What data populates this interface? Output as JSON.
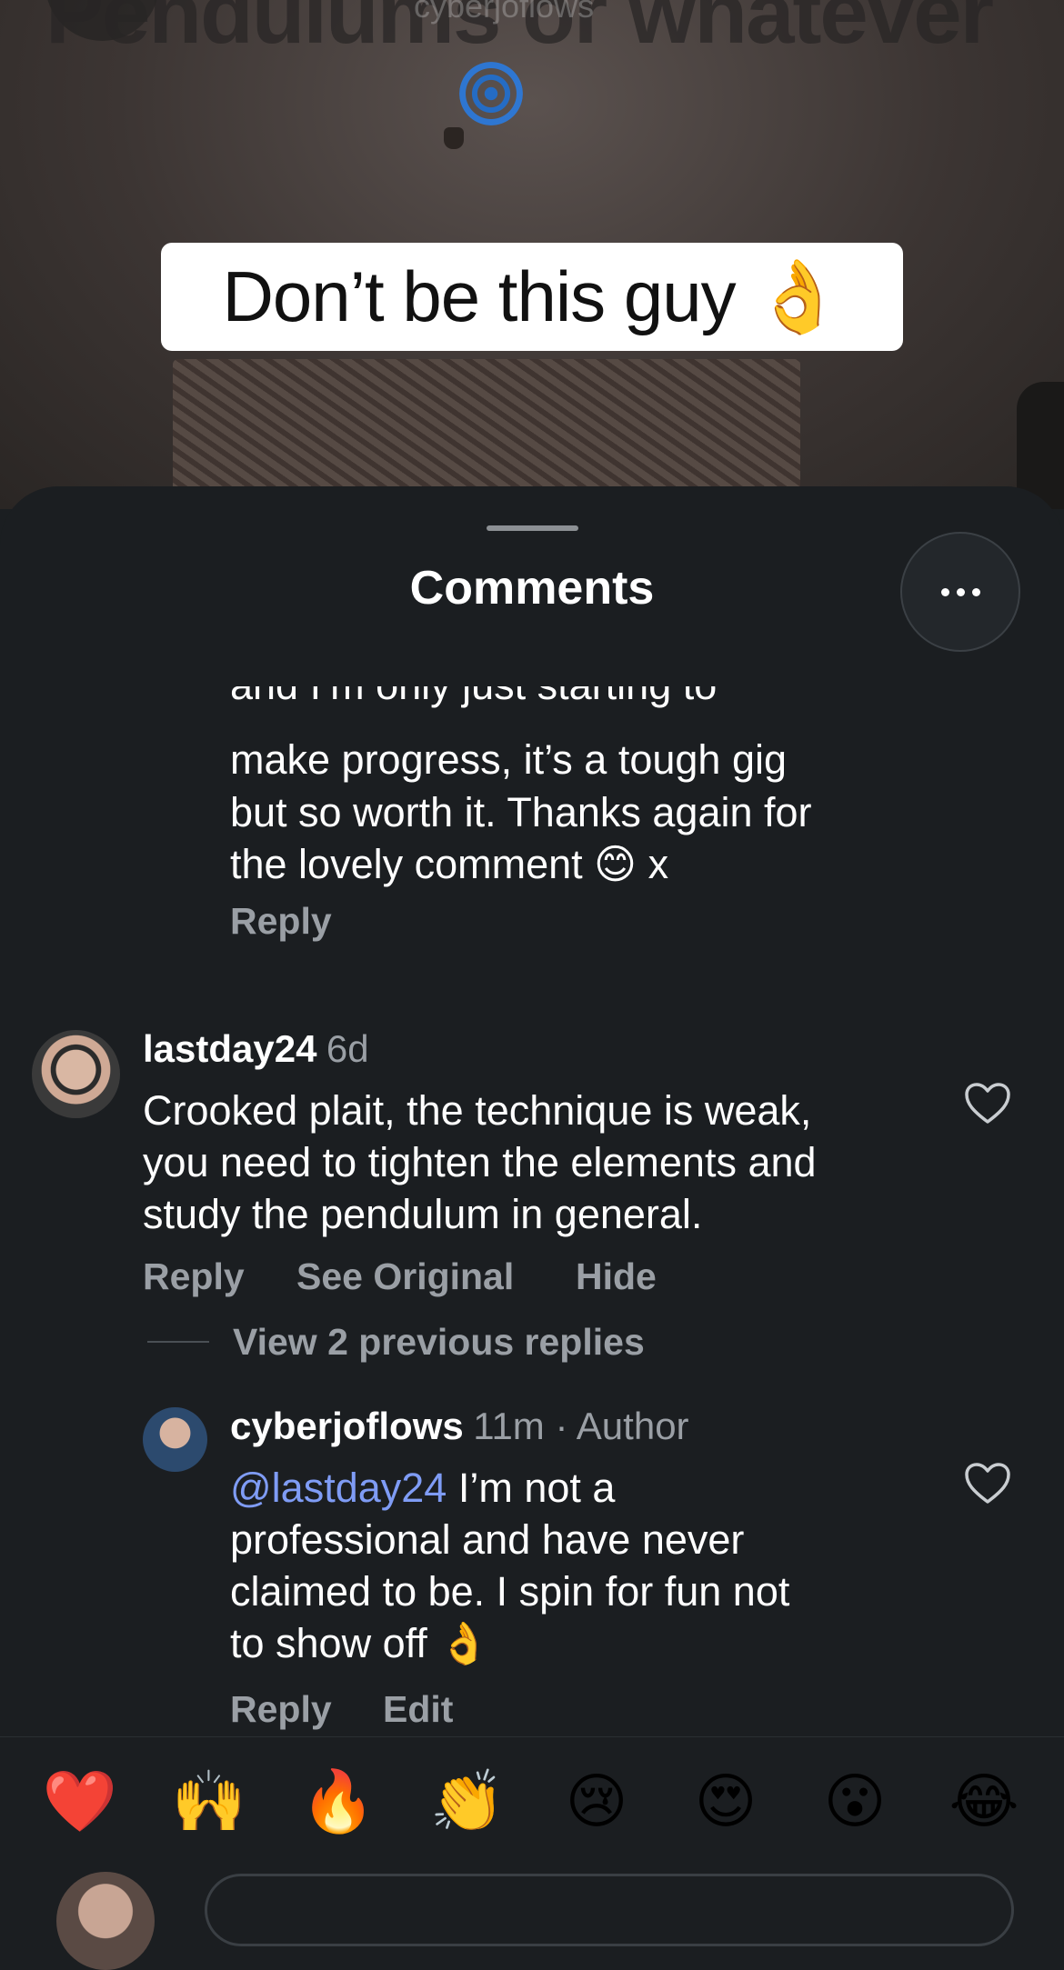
{
  "video": {
    "ghost_title": "Pendulums or whatever",
    "ghost_username": "cyberjoflows",
    "caption": "Don’t be this guy 👌"
  },
  "sheet": {
    "title": "Comments"
  },
  "previous_reply": {
    "line_partial": "and I’m only just starting to",
    "line_1": "make progress, it’s a tough gig",
    "line_2": "but so worth it. Thanks again for",
    "line_3": "the lovely comment 😊 x",
    "reply_label": "Reply"
  },
  "comment": {
    "username": "lastday24",
    "time": "6d",
    "line_1": "Crooked plait, the technique is weak,",
    "line_2": "you need to tighten the elements and",
    "line_3": "study the pendulum in general.",
    "reply_label": "Reply",
    "see_original_label": "See Original",
    "hide_label": "Hide",
    "view_replies_label": "View 2 previous replies"
  },
  "author_reply": {
    "username": "cyberjoflows",
    "meta": "11m · Author",
    "mention": "@lastday24",
    "line_1": "I’m not a",
    "line_2": "professional and have never",
    "line_3": "claimed to be. I spin for fun not",
    "line_4": "to show off 👌",
    "reply_label": "Reply",
    "edit_label": "Edit"
  },
  "reactions": [
    "❤️",
    "🙌",
    "🔥",
    "👏",
    "😢",
    "😍",
    "😮",
    "😂"
  ],
  "colors": {
    "sheet_bg": "#1b1e21",
    "text": "#ffffff",
    "muted": "#9a9fa5",
    "mention": "#7f9cf5"
  }
}
